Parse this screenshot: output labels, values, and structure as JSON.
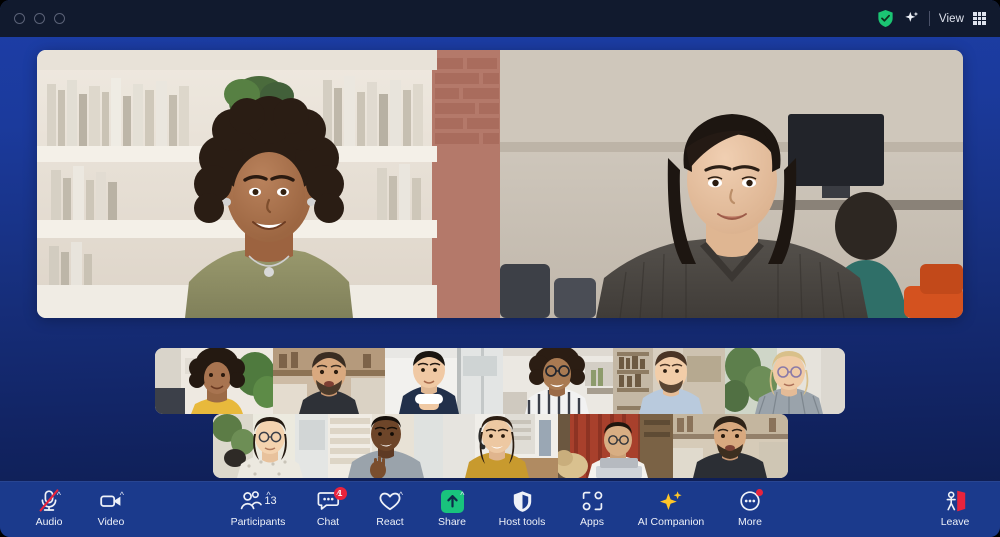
{
  "window": {
    "traffic_lights": [
      "close",
      "minimize",
      "maximize"
    ],
    "right_controls": {
      "encryption_icon": "green-shield-check-icon",
      "ai_icon": "sparkle-icon",
      "view_label": "View",
      "view_icon": "grid-layout-icon"
    }
  },
  "stage": {
    "speakers": [
      {
        "name": "active-speaker-left",
        "description": "Woman with curly hair in olive top, bookshelf background"
      },
      {
        "name": "active-speaker-right",
        "description": "Woman with dark bob haircut in grey top, office background"
      }
    ]
  },
  "filmstrip": {
    "row1": [
      {
        "id": "p1",
        "description": "Woman in yellow top, plants background"
      },
      {
        "id": "p2",
        "description": "Bearded man in dark tee, kitchen background"
      },
      {
        "id": "p3",
        "description": "Man in navy blazer, bright office"
      },
      {
        "id": "p4",
        "description": "Woman with glasses in striped top, office"
      },
      {
        "id": "p5",
        "description": "Man in light blue shirt, bookshelves"
      },
      {
        "id": "p6",
        "description": "Older woman with glasses, plants background"
      }
    ],
    "row2": [
      {
        "id": "p7",
        "description": "Woman with glasses in patterned blouse, kitchen"
      },
      {
        "id": "p8",
        "description": "Man in grey shirt gesturing, brick wall"
      },
      {
        "id": "p9",
        "description": "Woman with headset in mustard top, living room"
      },
      {
        "id": "p10",
        "description": "Person at laptop with dog, red panel background"
      },
      {
        "id": "p11",
        "description": "Bearded man in dark tee, wooden interior"
      }
    ]
  },
  "toolbar": {
    "left": [
      {
        "key": "audio",
        "label": "Audio",
        "icon": "microphone-muted-icon",
        "has_caret": true,
        "muted": true
      },
      {
        "key": "video",
        "label": "Video",
        "icon": "camera-icon",
        "has_caret": true,
        "muted": false
      }
    ],
    "center": [
      {
        "key": "participants",
        "label": "Participants",
        "icon": "people-icon",
        "count": "13",
        "has_caret": true
      },
      {
        "key": "chat",
        "label": "Chat",
        "icon": "chat-bubble-icon",
        "badge": "1",
        "has_caret": true
      },
      {
        "key": "react",
        "label": "React",
        "icon": "heart-icon",
        "has_caret": true
      },
      {
        "key": "share",
        "label": "Share",
        "icon": "share-screen-icon",
        "has_caret": true
      },
      {
        "key": "host_tools",
        "label": "Host tools",
        "icon": "shield-icon"
      },
      {
        "key": "apps",
        "label": "Apps",
        "icon": "apps-icon"
      },
      {
        "key": "ai_companion",
        "label": "AI Companion",
        "icon": "sparkles-icon"
      },
      {
        "key": "more",
        "label": "More",
        "icon": "more-dots-icon",
        "dot_badge": true
      }
    ],
    "right": [
      {
        "key": "leave",
        "label": "Leave",
        "icon": "leave-door-icon"
      }
    ]
  },
  "colors": {
    "titlebar": "#111a2e",
    "toolbar": "#1b3a8c",
    "background_top": "#1c3ea8",
    "background_bottom": "#0d1b4a",
    "accent_green": "#19c37d",
    "badge_red": "#e8233c",
    "ai_yellow": "#ffc629",
    "leave_red": "#e8233c"
  }
}
